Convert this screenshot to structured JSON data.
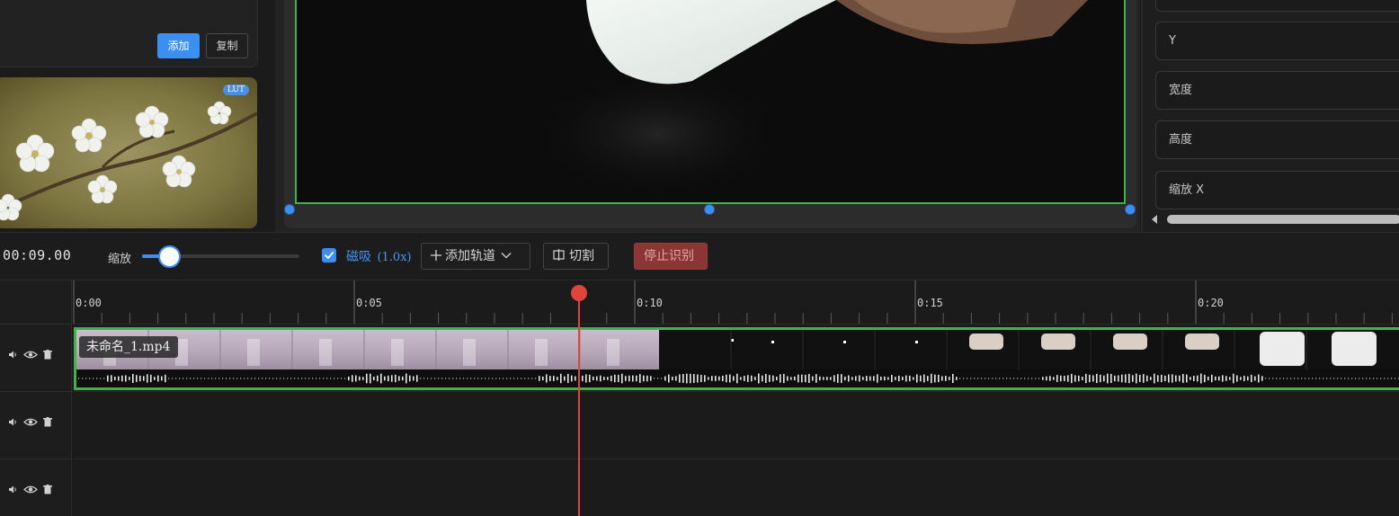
{
  "assets": {
    "add_label": "添加",
    "copy_label": "复制",
    "thumbnail_badge": "LUT"
  },
  "properties": {
    "fields": [
      "Y",
      "宽度",
      "高度",
      "缩放 X"
    ]
  },
  "toolbar": {
    "timecode": "00:09.00",
    "zoom_label": "缩放",
    "zoom_level": 0.12,
    "snap_label": "磁吸",
    "snap_multiplier": "(1.0x)",
    "snap_checked": true,
    "add_track_label": "添加轨道",
    "cut_label": "切割",
    "stop_recognition_label": "停止识别"
  },
  "timeline": {
    "ruler_labels": [
      "0:00",
      "0:05",
      "0:10",
      "0:15",
      "0:20"
    ],
    "playhead_time_s": 9.0,
    "clip_name": "未命名_1.mp4",
    "track_count": 3
  },
  "colors": {
    "accent": "#3d8fef",
    "clip_border": "#3db34a",
    "playhead": "#e0453d",
    "stop_button": "#8b3535"
  }
}
